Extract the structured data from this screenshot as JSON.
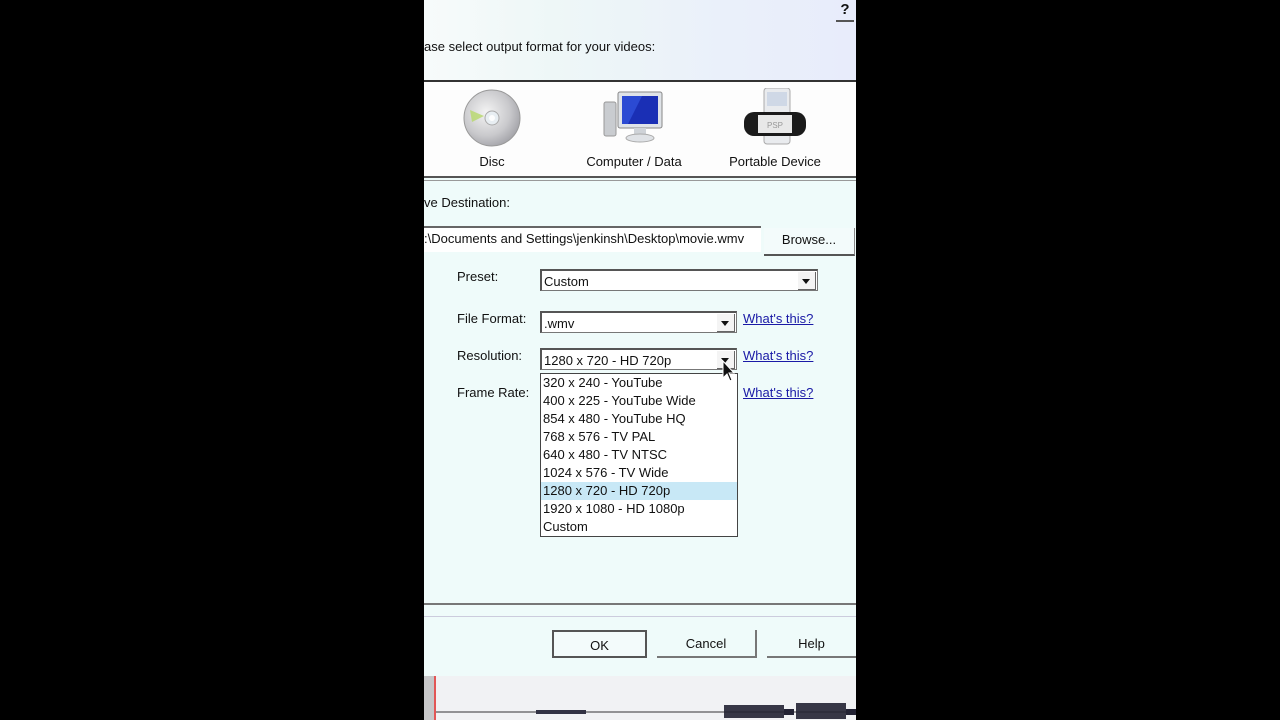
{
  "dialog": {
    "help_glyph": "?",
    "instruction": "ase select output format for your videos:",
    "categories": [
      {
        "label": "Disc",
        "icon": "disc-icon"
      },
      {
        "label": "Computer / Data",
        "icon": "computer-icon"
      },
      {
        "label": "Portable Device",
        "icon": "portable-device-icon"
      }
    ],
    "save_destination_label": "ve Destination:",
    "save_path": ":\\Documents and Settings\\jenkinsh\\Desktop\\movie.wmv",
    "browse_label": "Browse...",
    "fields": {
      "preset": {
        "label": "Preset:",
        "value": "Custom"
      },
      "file_format": {
        "label": "File Format:",
        "value": ".wmv",
        "help_link": "What's this?"
      },
      "resolution": {
        "label": "Resolution:",
        "value": "1280 x 720 - HD 720p",
        "help_link": "What's this?"
      },
      "frame_rate": {
        "label": "Frame Rate:",
        "help_link": "What's this?"
      }
    },
    "resolution_options": [
      "320 x 240 - YouTube",
      "400 x 225 - YouTube Wide",
      "854 x 480 - YouTube HQ",
      "768 x 576 - TV PAL",
      "640 x 480 - TV NTSC",
      "1024 x 576 - TV Wide",
      "1280 x 720 - HD 720p",
      "1920 x 1080 - HD 1080p",
      "Custom"
    ],
    "resolution_selected_index": 6,
    "buttons": {
      "ok": "OK",
      "cancel": "Cancel",
      "help": "Help"
    },
    "colors": {
      "link": "#1a1aa6",
      "highlight": "#c8e8f6",
      "background": "#effbfa"
    }
  }
}
